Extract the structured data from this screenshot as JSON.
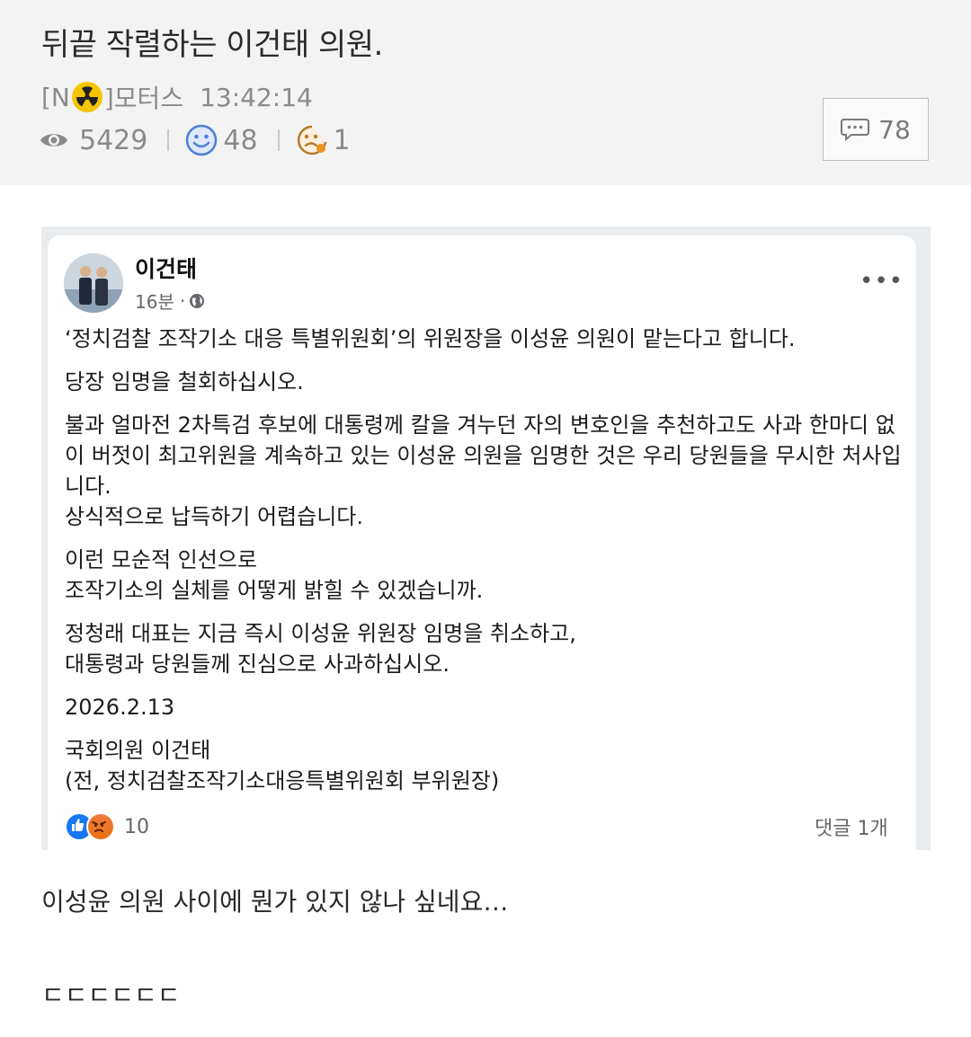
{
  "post": {
    "title": "뒤끝 작렬하는 이건태 의원.",
    "author_prefix": "[N",
    "author_suffix": "]모터스",
    "time": "13:42:14",
    "views": "5429",
    "likes": "48",
    "dislikes": "1",
    "comment_count": "78"
  },
  "facebook_post": {
    "author": "이건태",
    "time": "16분",
    "time_separator": "·",
    "paragraphs": [
      "‘정치검찰 조작기소 대응 특별위원회’의 위원장을 이성윤 의원이 맡는다고 합니다.",
      "당장 임명을 철회하십시오.",
      "불과 얼마전 2차특검 후보에 대통령께 칼을 겨누던 자의 변호인을 추천하고도 사과 한마디 없이 버젓이 최고위원을 계속하고 있는 이성윤 의원을 임명한 것은 우리 당원들을 무시한 처사입니다.\n상식적으로 납득하기 어렵습니다.",
      "이런 모순적 인선으로\n조작기소의 실체를 어떻게 밝힐 수 있겠습니까.",
      "정청래 대표는 지금 즉시 이성윤 위원장 임명을 취소하고,\n대통령과 당원들께 진심으로 사과하십시오.",
      "2026.2.13",
      "국회의원 이건태\n(전, 정치검찰조작기소대응특별위원회 부위원장)"
    ],
    "reaction_count": "10",
    "comments_label": "댓글 1개"
  },
  "footer": {
    "line1": "이성윤 의원 사이에 뭔가 있지 않나 싶네요…",
    "line2": "ㄷㄷㄷㄷㄷㄷ"
  },
  "icons": {
    "views": "eye-icon",
    "likes": "smile-icon",
    "dislikes": "frown-icon",
    "comments": "speech-bubble-icon",
    "author_badge": "radiation-icon",
    "privacy": "globe-icon",
    "menu": "more-horizontal-icon"
  },
  "colors": {
    "header_bg": "#f3f3f3",
    "badge_yellow": "#f5c400",
    "like_blue": "#1877f2",
    "smile_blue": "#4a7fd6",
    "frown_orange": "#e8931e"
  }
}
